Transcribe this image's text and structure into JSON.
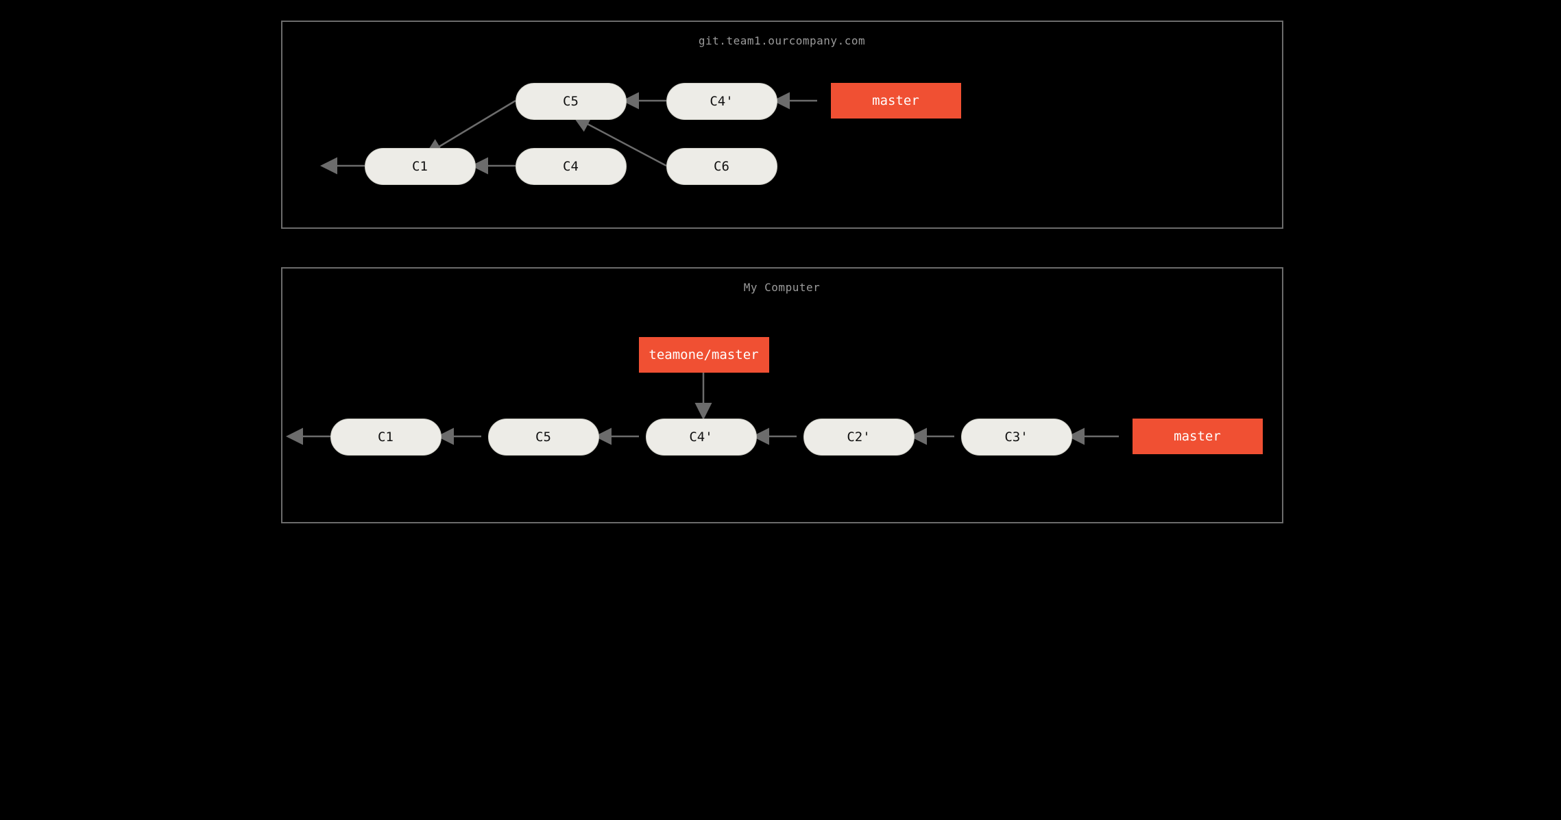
{
  "panels": {
    "remote": {
      "title": "git.team1.ourcompany.com"
    },
    "local": {
      "title": "My Computer"
    }
  },
  "commits": {
    "r_c1": "C1",
    "r_c4": "C4",
    "r_c5": "C5",
    "r_c6": "C6",
    "r_c4p": "C4'",
    "l_c1": "C1",
    "l_c5": "C5",
    "l_c4p": "C4'",
    "l_c2p": "C2'",
    "l_c3p": "C3'"
  },
  "branches": {
    "r_master": "master",
    "l_teamone": "teamone/master",
    "l_master": "master"
  }
}
